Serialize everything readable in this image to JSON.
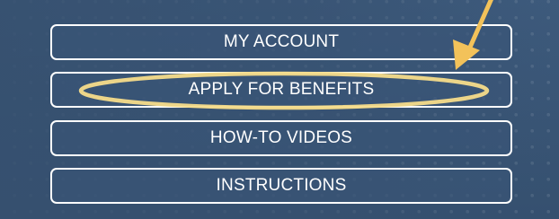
{
  "menu": {
    "items": [
      {
        "label": "MY ACCOUNT"
      },
      {
        "label": "APPLY FOR BENEFITS"
      },
      {
        "label": "HOW-TO VIDEOS"
      },
      {
        "label": "INSTRUCTIONS"
      }
    ]
  },
  "colors": {
    "background": "#3a5678",
    "button_border": "#ffffff",
    "button_text": "#ffffff",
    "highlight": "#f5dc8a",
    "arrow": "#f3c25a"
  },
  "annotation": {
    "highlighted_item": "APPLY FOR BENEFITS",
    "icons": [
      "highlight-ellipse",
      "pointer-arrow-icon"
    ]
  }
}
